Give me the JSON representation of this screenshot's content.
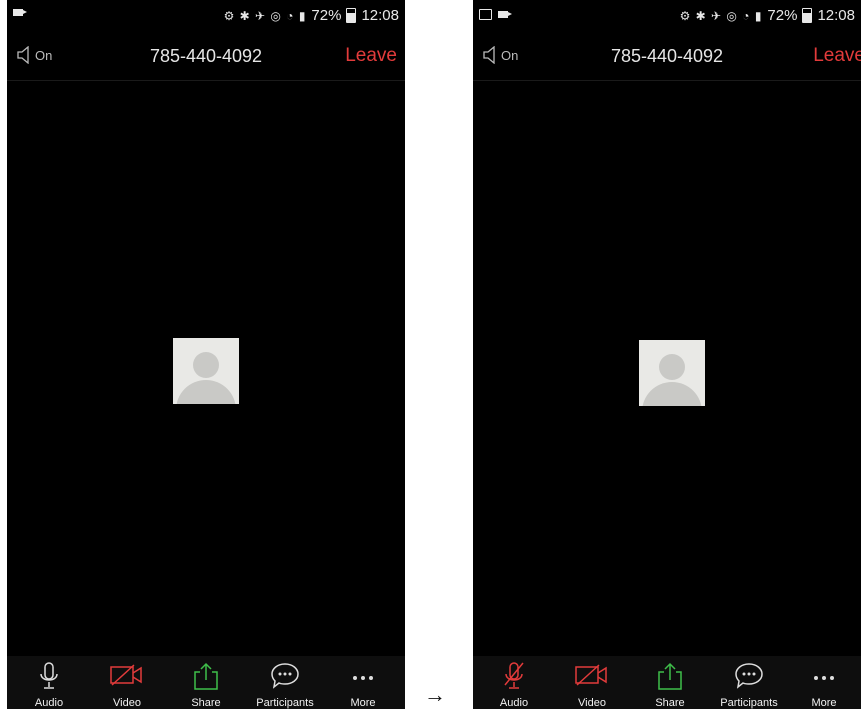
{
  "screens": [
    {
      "status": {
        "battery": "72%",
        "time": "12:08"
      },
      "speaker_label": "On",
      "call_title": "785-440-4092",
      "leave_label": "Leave",
      "toolbar": {
        "audio": "Audio",
        "video": "Video",
        "share": "Share",
        "participants": "Participants",
        "more": "More"
      }
    },
    {
      "status": {
        "battery": "72%",
        "time": "12:08"
      },
      "speaker_label": "On",
      "call_title": "785-440-4092",
      "leave_label": "Leave",
      "toolbar": {
        "audio": "Audio",
        "video": "Video",
        "share": "Share",
        "participants": "Participants",
        "more": "More"
      }
    }
  ],
  "transition_arrow": "→",
  "colors": {
    "leave": "#e23b3b",
    "video_off": "#e23b3b",
    "audio_muted": "#e23b3b",
    "share": "#3fbf4a",
    "background": "#000000"
  },
  "icons": {
    "audio_left": "microphone-icon",
    "audio_right": "microphone-muted-icon",
    "video": "video-off-icon",
    "share": "share-icon",
    "participants": "chat-bubble-icon",
    "more": "more-dots-icon"
  }
}
